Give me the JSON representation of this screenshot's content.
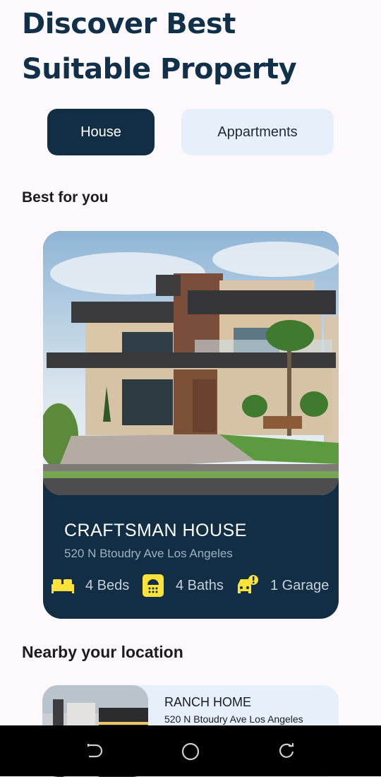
{
  "header": {
    "title_line1": "Discover Best",
    "title_line2": "Suitable Property"
  },
  "tabs": [
    {
      "label": "House",
      "selected": true
    },
    {
      "label": "Appartments",
      "selected": false
    }
  ],
  "sections": {
    "best_for_you": "Best for you",
    "nearby": "Nearby your location"
  },
  "featured": {
    "name": "CRAFTSMAN HOUSE",
    "address": "520 N Btoudry Ave Los Angeles",
    "beds": "4 Beds",
    "baths": "4 Baths",
    "garage": "1 Garage",
    "icons": [
      "bed-icon",
      "bath-icon",
      "garage-icon"
    ]
  },
  "nearby_items": [
    {
      "name": "RANCH HOME",
      "address": "520 N Btoudry Ave Los Angeles"
    }
  ],
  "colors": {
    "primary": "#122e45",
    "accent_icon": "#ffe23a",
    "tab_inactive": "#e6f0fb",
    "background": "#fdf8fc"
  },
  "system_nav": [
    "back-icon",
    "home-icon",
    "recents-icon"
  ]
}
